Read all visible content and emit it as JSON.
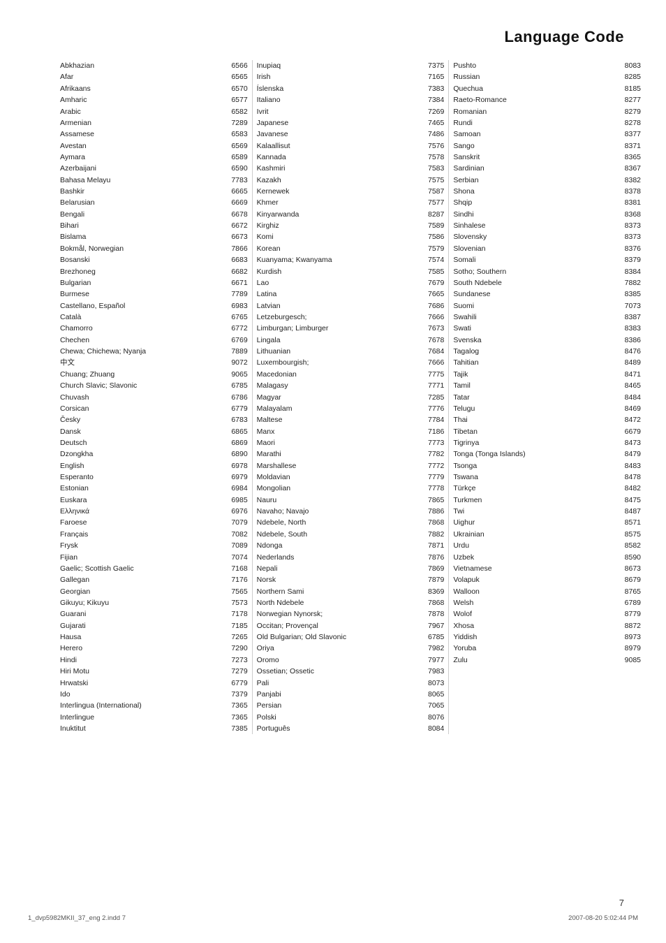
{
  "page": {
    "title": "Language Code",
    "number": "7",
    "footer_left": "1_dvp5982MKII_37_eng 2.indd   7",
    "footer_right": "2007-08-20   5:02:44 PM"
  },
  "columns": [
    {
      "entries": [
        {
          "name": "Abkhazian",
          "code": "6566"
        },
        {
          "name": "Afar",
          "code": "6565"
        },
        {
          "name": "Afrikaans",
          "code": "6570"
        },
        {
          "name": "Amharic",
          "code": "6577"
        },
        {
          "name": "Arabic",
          "code": "6582"
        },
        {
          "name": "Armenian",
          "code": "7289"
        },
        {
          "name": "Assamese",
          "code": "6583"
        },
        {
          "name": "Avestan",
          "code": "6569"
        },
        {
          "name": "Aymara",
          "code": "6589"
        },
        {
          "name": "Azerbaijani",
          "code": "6590"
        },
        {
          "name": "Bahasa Melayu",
          "code": "7783"
        },
        {
          "name": "Bashkir",
          "code": "6665"
        },
        {
          "name": "Belarusian",
          "code": "6669"
        },
        {
          "name": "Bengali",
          "code": "6678"
        },
        {
          "name": "Bihari",
          "code": "6672"
        },
        {
          "name": "Bislama",
          "code": "6673"
        },
        {
          "name": "Bokmål, Norwegian",
          "code": "7866"
        },
        {
          "name": "Bosanski",
          "code": "6683"
        },
        {
          "name": "Brezhoneg",
          "code": "6682"
        },
        {
          "name": "Bulgarian",
          "code": "6671"
        },
        {
          "name": "Burmese",
          "code": "7789"
        },
        {
          "name": "Castellano, Español",
          "code": "6983"
        },
        {
          "name": "Català",
          "code": "6765"
        },
        {
          "name": "Chamorro",
          "code": "6772"
        },
        {
          "name": "Chechen",
          "code": "6769"
        },
        {
          "name": "Chewa; Chichewa; Nyanja",
          "code": "7889"
        },
        {
          "name": "中文",
          "code": "9072"
        },
        {
          "name": "Chuang; Zhuang",
          "code": "9065"
        },
        {
          "name": "Church Slavic; Slavonic",
          "code": "6785"
        },
        {
          "name": "Chuvash",
          "code": "6786"
        },
        {
          "name": "Corsican",
          "code": "6779"
        },
        {
          "name": "Česky",
          "code": "6783"
        },
        {
          "name": "Dansk",
          "code": "6865"
        },
        {
          "name": "Deutsch",
          "code": "6869"
        },
        {
          "name": "Dzongkha",
          "code": "6890"
        },
        {
          "name": "English",
          "code": "6978"
        },
        {
          "name": "Esperanto",
          "code": "6979"
        },
        {
          "name": "Estonian",
          "code": "6984"
        },
        {
          "name": "Euskara",
          "code": "6985"
        },
        {
          "name": "Ελληνικά",
          "code": "6976"
        },
        {
          "name": "Faroese",
          "code": "7079"
        },
        {
          "name": "Français",
          "code": "7082"
        },
        {
          "name": "Frysk",
          "code": "7089"
        },
        {
          "name": "Fijian",
          "code": "7074"
        },
        {
          "name": "Gaelic; Scottish Gaelic",
          "code": "7168"
        },
        {
          "name": "Gallegan",
          "code": "7176"
        },
        {
          "name": "Georgian",
          "code": "7565"
        },
        {
          "name": "Gikuyu; Kikuyu",
          "code": "7573"
        },
        {
          "name": "Guarani",
          "code": "7178"
        },
        {
          "name": "Gujarati",
          "code": "7185"
        },
        {
          "name": "Hausa",
          "code": "7265"
        },
        {
          "name": "Herero",
          "code": "7290"
        },
        {
          "name": "Hindi",
          "code": "7273"
        },
        {
          "name": "Hiri Motu",
          "code": "7279"
        },
        {
          "name": "Hrwatski",
          "code": "6779"
        },
        {
          "name": "Ido",
          "code": "7379"
        },
        {
          "name": "Interlingua (International)",
          "code": "7365"
        },
        {
          "name": "Interlingue",
          "code": "7365"
        },
        {
          "name": "Inuktitut",
          "code": "7385"
        }
      ]
    },
    {
      "entries": [
        {
          "name": "Inupiaq",
          "code": "7375"
        },
        {
          "name": "Irish",
          "code": "7165"
        },
        {
          "name": "Íslenska",
          "code": "7383"
        },
        {
          "name": "Italiano",
          "code": "7384"
        },
        {
          "name": "Ivrit",
          "code": "7269"
        },
        {
          "name": "Japanese",
          "code": "7465"
        },
        {
          "name": "Javanese",
          "code": "7486"
        },
        {
          "name": "Kalaallisut",
          "code": "7576"
        },
        {
          "name": "Kannada",
          "code": "7578"
        },
        {
          "name": "Kashmiri",
          "code": "7583"
        },
        {
          "name": "Kazakh",
          "code": "7575"
        },
        {
          "name": "Kernewek",
          "code": "7587"
        },
        {
          "name": "Khmer",
          "code": "7577"
        },
        {
          "name": "Kinyarwanda",
          "code": "8287"
        },
        {
          "name": "Kirghiz",
          "code": "7589"
        },
        {
          "name": "Komi",
          "code": "7586"
        },
        {
          "name": "Korean",
          "code": "7579"
        },
        {
          "name": "Kuanyama; Kwanyama",
          "code": "7574"
        },
        {
          "name": "Kurdish",
          "code": "7585"
        },
        {
          "name": "Lao",
          "code": "7679"
        },
        {
          "name": "Latina",
          "code": "7665"
        },
        {
          "name": "Latvian",
          "code": "7686"
        },
        {
          "name": "Letzeburgesch;",
          "code": "7666"
        },
        {
          "name": "Limburgan; Limburger",
          "code": "7673"
        },
        {
          "name": "Lingala",
          "code": "7678"
        },
        {
          "name": "Lithuanian",
          "code": "7684"
        },
        {
          "name": "Luxembourgish;",
          "code": "7666"
        },
        {
          "name": "Macedonian",
          "code": "7775"
        },
        {
          "name": "Malagasy",
          "code": "7771"
        },
        {
          "name": "Magyar",
          "code": "7285"
        },
        {
          "name": "Malayalam",
          "code": "7776"
        },
        {
          "name": "Maltese",
          "code": "7784"
        },
        {
          "name": "Manx",
          "code": "7186"
        },
        {
          "name": "Maori",
          "code": "7773"
        },
        {
          "name": "Marathi",
          "code": "7782"
        },
        {
          "name": "Marshallese",
          "code": "7772"
        },
        {
          "name": "Moldavian",
          "code": "7779"
        },
        {
          "name": "Mongolian",
          "code": "7778"
        },
        {
          "name": "Nauru",
          "code": "7865"
        },
        {
          "name": "Navaho; Navajo",
          "code": "7886"
        },
        {
          "name": "Ndebele, North",
          "code": "7868"
        },
        {
          "name": "Ndebele, South",
          "code": "7882"
        },
        {
          "name": "Ndonga",
          "code": "7871"
        },
        {
          "name": "Nederlands",
          "code": "7876"
        },
        {
          "name": "Nepali",
          "code": "7869"
        },
        {
          "name": "Norsk",
          "code": "7879"
        },
        {
          "name": "Northern Sami",
          "code": "8369"
        },
        {
          "name": "North Ndebele",
          "code": "7868"
        },
        {
          "name": "Norwegian Nynorsk;",
          "code": "7878"
        },
        {
          "name": "Occitan; Provençal",
          "code": "7967"
        },
        {
          "name": "Old Bulgarian; Old Slavonic",
          "code": "6785"
        },
        {
          "name": "Oriya",
          "code": "7982"
        },
        {
          "name": "Oromo",
          "code": "7977"
        },
        {
          "name": "Ossetian; Ossetic",
          "code": "7983"
        },
        {
          "name": "Pali",
          "code": "8073"
        },
        {
          "name": "Panjabi",
          "code": "8065"
        },
        {
          "name": "Persian",
          "code": "7065"
        },
        {
          "name": "Polski",
          "code": "8076"
        },
        {
          "name": "Português",
          "code": "8084"
        }
      ]
    },
    {
      "entries": [
        {
          "name": "Pushto",
          "code": "8083"
        },
        {
          "name": "Russian",
          "code": "8285"
        },
        {
          "name": "Quechua",
          "code": "8185"
        },
        {
          "name": "Raeto-Romance",
          "code": "8277"
        },
        {
          "name": "Romanian",
          "code": "8279"
        },
        {
          "name": "Rundi",
          "code": "8278"
        },
        {
          "name": "Samoan",
          "code": "8377"
        },
        {
          "name": "Sango",
          "code": "8371"
        },
        {
          "name": "Sanskrit",
          "code": "8365"
        },
        {
          "name": "Sardinian",
          "code": "8367"
        },
        {
          "name": "Serbian",
          "code": "8382"
        },
        {
          "name": "Shona",
          "code": "8378"
        },
        {
          "name": "Shqip",
          "code": "8381"
        },
        {
          "name": "Sindhi",
          "code": "8368"
        },
        {
          "name": "Sinhalese",
          "code": "8373"
        },
        {
          "name": "Slovensky",
          "code": "8373"
        },
        {
          "name": "Slovenian",
          "code": "8376"
        },
        {
          "name": "Somali",
          "code": "8379"
        },
        {
          "name": "Sotho; Southern",
          "code": "8384"
        },
        {
          "name": "South Ndebele",
          "code": "7882"
        },
        {
          "name": "Sundanese",
          "code": "8385"
        },
        {
          "name": "Suomi",
          "code": "7073"
        },
        {
          "name": "Swahili",
          "code": "8387"
        },
        {
          "name": "Swati",
          "code": "8383"
        },
        {
          "name": "Svenska",
          "code": "8386"
        },
        {
          "name": "Tagalog",
          "code": "8476"
        },
        {
          "name": "Tahitian",
          "code": "8489"
        },
        {
          "name": "Tajik",
          "code": "8471"
        },
        {
          "name": "Tamil",
          "code": "8465"
        },
        {
          "name": "Tatar",
          "code": "8484"
        },
        {
          "name": "Telugu",
          "code": "8469"
        },
        {
          "name": "Thai",
          "code": "8472"
        },
        {
          "name": "Tibetan",
          "code": "6679"
        },
        {
          "name": "Tigrinya",
          "code": "8473"
        },
        {
          "name": "Tonga (Tonga Islands)",
          "code": "8479"
        },
        {
          "name": "Tsonga",
          "code": "8483"
        },
        {
          "name": "Tswana",
          "code": "8478"
        },
        {
          "name": "Türkçe",
          "code": "8482"
        },
        {
          "name": "Turkmen",
          "code": "8475"
        },
        {
          "name": "Twi",
          "code": "8487"
        },
        {
          "name": "Uighur",
          "code": "8571"
        },
        {
          "name": "Ukrainian",
          "code": "8575"
        },
        {
          "name": "Urdu",
          "code": "8582"
        },
        {
          "name": "Uzbek",
          "code": "8590"
        },
        {
          "name": "Vietnamese",
          "code": "8673"
        },
        {
          "name": "Volapuk",
          "code": "8679"
        },
        {
          "name": "Walloon",
          "code": "8765"
        },
        {
          "name": "Welsh",
          "code": "6789"
        },
        {
          "name": "Wolof",
          "code": "8779"
        },
        {
          "name": "Xhosa",
          "code": "8872"
        },
        {
          "name": "Yiddish",
          "code": "8973"
        },
        {
          "name": "Yoruba",
          "code": "8979"
        },
        {
          "name": "Zulu",
          "code": "9085"
        }
      ]
    }
  ]
}
